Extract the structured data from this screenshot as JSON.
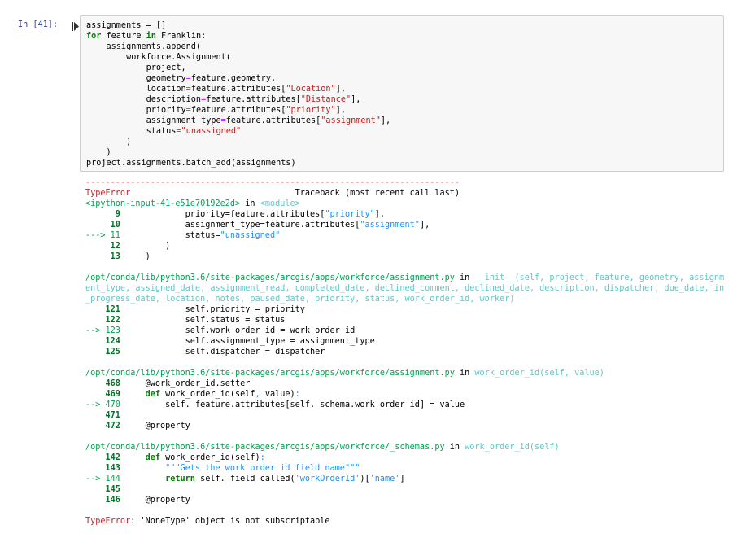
{
  "cell": {
    "prompt": "In [41]:",
    "run_icon": "step-run-icon"
  },
  "code_lines": [
    [
      {
        "t": "assignments = []"
      }
    ],
    [
      {
        "t": "for",
        "c": "kw"
      },
      {
        "t": " feature "
      },
      {
        "t": "in",
        "c": "kw"
      },
      {
        "t": " Franklin:"
      }
    ],
    [
      {
        "t": "    assignments.append("
      }
    ],
    [
      {
        "t": "        workforce.Assignment("
      }
    ],
    [
      {
        "t": "            project,"
      }
    ],
    [
      {
        "t": "            geometry"
      },
      {
        "t": "=",
        "c": "op"
      },
      {
        "t": "feature.geometry,"
      }
    ],
    [
      {
        "t": "            location"
      },
      {
        "t": "=",
        "c": "op"
      },
      {
        "t": "feature.attributes["
      },
      {
        "t": "\"Location\"",
        "c": "str"
      },
      {
        "t": "],"
      }
    ],
    [
      {
        "t": "            description"
      },
      {
        "t": "=",
        "c": "op"
      },
      {
        "t": "feature.attributes["
      },
      {
        "t": "\"Distance\"",
        "c": "str"
      },
      {
        "t": "],"
      }
    ],
    [
      {
        "t": "            priority"
      },
      {
        "t": "=",
        "c": "op"
      },
      {
        "t": "feature.attributes["
      },
      {
        "t": "\"priority\"",
        "c": "str"
      },
      {
        "t": "],"
      }
    ],
    [
      {
        "t": "            assignment_type"
      },
      {
        "t": "=",
        "c": "op"
      },
      {
        "t": "feature.attributes["
      },
      {
        "t": "\"assignment\"",
        "c": "str"
      },
      {
        "t": "],"
      }
    ],
    [
      {
        "t": "            status"
      },
      {
        "t": "=",
        "c": "op"
      },
      {
        "t": "\"unassigned\"",
        "c": "str"
      }
    ],
    [
      {
        "t": "        )"
      }
    ],
    [
      {
        "t": "    )"
      }
    ],
    [
      {
        "t": "project.assignments.batch_add(assignments)"
      }
    ]
  ],
  "output": {
    "dash_line": "---------------------------------------------------------------------------",
    "header": [
      {
        "t": "TypeError",
        "c": "red"
      },
      {
        "t": "                                 Traceback (most recent call last)"
      }
    ],
    "frames": [
      {
        "loc": [
          {
            "t": "<ipython-input-41-e51e70192e2d>",
            "c": "green"
          },
          {
            "t": " in "
          },
          {
            "t": "<module>",
            "c": "cyan"
          }
        ],
        "wrap": false,
        "lines": [
          [
            {
              "t": "      9",
              "c": "ngreen"
            },
            {
              "t": "             priority=feature.attributes["
            },
            {
              "t": "\"priority\"",
              "c": "tstr"
            },
            {
              "t": "],"
            }
          ],
          [
            {
              "t": "     10",
              "c": "ngreen"
            },
            {
              "t": "             assignment_type=feature.attributes["
            },
            {
              "t": "\"assignment\"",
              "c": "tstr"
            },
            {
              "t": "],"
            }
          ],
          [
            {
              "t": "---> 11",
              "c": "green"
            },
            {
              "t": "             status="
            },
            {
              "t": "\"unassigned\"",
              "c": "tstr"
            }
          ],
          [
            {
              "t": "     12",
              "c": "ngreen"
            },
            {
              "t": "         )"
            }
          ],
          [
            {
              "t": "     13",
              "c": "ngreen"
            },
            {
              "t": "     )"
            }
          ]
        ]
      },
      {
        "loc": [
          {
            "t": "/opt/conda/lib/python3.6/site-packages/arcgis/apps/workforce/assignment.py",
            "c": "green"
          },
          {
            "t": " in "
          },
          {
            "t": "__init__(self, project, feature, geometry, assignment_type, assigned_date, assignment_read, completed_date, declined_comment, declined_date, description, dispatcher, due_date, in_progress_date, location, notes, paused_date, priority, status, work_order_id, worker)",
            "c": "cyan"
          }
        ],
        "wrap": true,
        "lines": [
          [
            {
              "t": "    121",
              "c": "ngreen"
            },
            {
              "t": "             self.priority = priority"
            }
          ],
          [
            {
              "t": "    122",
              "c": "ngreen"
            },
            {
              "t": "             self.status = status"
            }
          ],
          [
            {
              "t": "--> 123",
              "c": "green"
            },
            {
              "t": "             self.work_order_id = work_order_id"
            }
          ],
          [
            {
              "t": "    124",
              "c": "ngreen"
            },
            {
              "t": "             self.assignment_type = assignment_type"
            }
          ],
          [
            {
              "t": "    125",
              "c": "ngreen"
            },
            {
              "t": "             self.dispatcher = dispatcher"
            }
          ]
        ]
      },
      {
        "loc": [
          {
            "t": "/opt/conda/lib/python3.6/site-packages/arcgis/apps/workforce/assignment.py",
            "c": "green"
          },
          {
            "t": " in "
          },
          {
            "t": "work_order_id(self, value)",
            "c": "cyan"
          }
        ],
        "wrap": false,
        "lines": [
          [
            {
              "t": "    468",
              "c": "ngreen"
            },
            {
              "t": "     @work_order_id.setter"
            }
          ],
          [
            {
              "t": "    469",
              "c": "ngreen"
            },
            {
              "t": "     def",
              "c": "kwb"
            },
            {
              "t": " work_order_id(self"
            },
            {
              "t": ",",
              "c": "tstr"
            },
            {
              "t": " value)"
            },
            {
              "t": ":",
              "c": "tstr"
            }
          ],
          [
            {
              "t": "--> 470",
              "c": "green"
            },
            {
              "t": "         self._feature.attributes[self._schema.work_order_id] = value"
            }
          ],
          [
            {
              "t": "    471",
              "c": "ngreen"
            },
            {
              "t": ""
            }
          ],
          [
            {
              "t": "    472",
              "c": "ngreen"
            },
            {
              "t": "     @property"
            }
          ]
        ]
      },
      {
        "loc": [
          {
            "t": "/opt/conda/lib/python3.6/site-packages/arcgis/apps/workforce/_schemas.py",
            "c": "green"
          },
          {
            "t": " in "
          },
          {
            "t": "work_order_id(self)",
            "c": "cyan"
          }
        ],
        "wrap": false,
        "lines": [
          [
            {
              "t": "    142",
              "c": "ngreen"
            },
            {
              "t": "     def",
              "c": "kwb"
            },
            {
              "t": " work_order_id(self)"
            },
            {
              "t": ":",
              "c": "tstr"
            }
          ],
          [
            {
              "t": "    143",
              "c": "ngreen"
            },
            {
              "t": "         "
            },
            {
              "t": "\"\"\"Gets the work order id field name\"\"\"",
              "c": "tstr"
            }
          ],
          [
            {
              "t": "--> 144",
              "c": "green"
            },
            {
              "t": "         return",
              "c": "kwb"
            },
            {
              "t": " self._field_called("
            },
            {
              "t": "'workOrderId'",
              "c": "tstr"
            },
            {
              "t": ")["
            },
            {
              "t": "'name'",
              "c": "tstr"
            },
            {
              "t": "]"
            }
          ],
          [
            {
              "t": "    145",
              "c": "ngreen"
            },
            {
              "t": ""
            }
          ],
          [
            {
              "t": "    146",
              "c": "ngreen"
            },
            {
              "t": "     @property"
            }
          ]
        ]
      }
    ],
    "final_error": [
      {
        "t": "TypeError",
        "c": "red"
      },
      {
        "t": ": 'NoneType' object is not subscriptable"
      }
    ]
  },
  "colors": {
    "prompt": "#303f9f",
    "cell_bg": "#f7f7f7",
    "keyword": "#008000",
    "string": "#ba2121",
    "error_red": "#b22b31",
    "trace_green": "#00a250",
    "trace_cyan": "#60c6c8",
    "trace_blue": "#208ffb"
  }
}
